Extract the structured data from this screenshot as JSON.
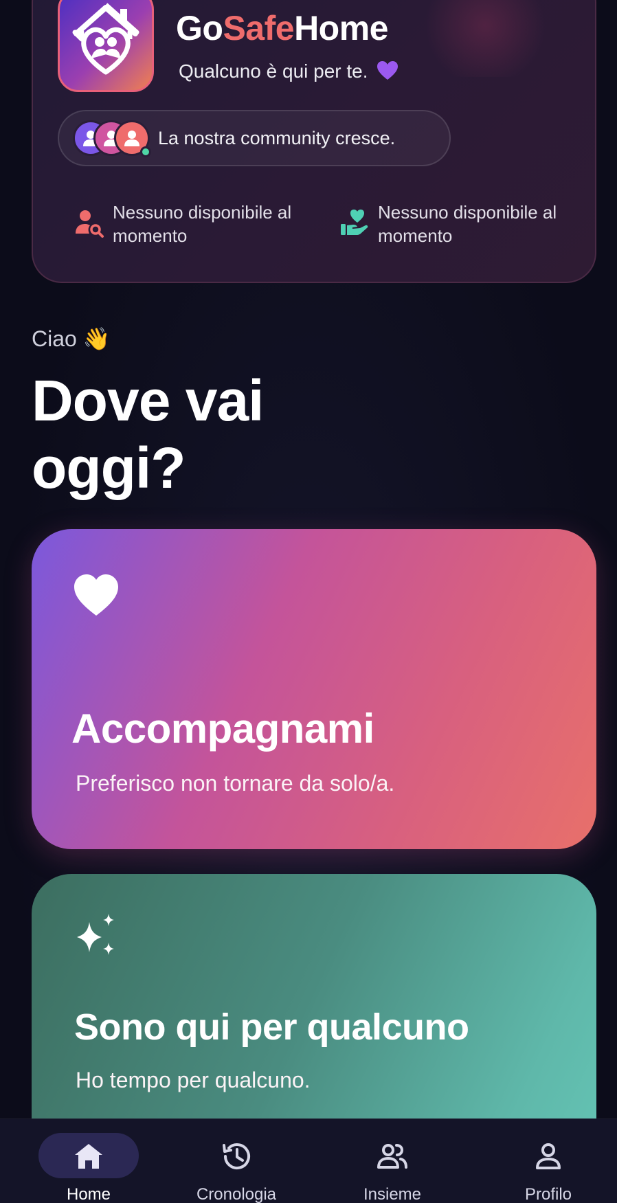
{
  "header": {
    "brand": {
      "part1": "Go",
      "part2": "Safe",
      "part3": "Home"
    },
    "tagline": "Qualcuno è qui per te.",
    "tagline_emoji": "💜",
    "community_text": "La nostra community cresce.",
    "stats": [
      {
        "icon": "person-search-icon",
        "text": "Nessuno disponibile al momento"
      },
      {
        "icon": "hand-heart-icon",
        "text": "Nessuno disponibile al momento"
      }
    ]
  },
  "greeting": {
    "hello": "Ciao",
    "hello_emoji": "👋",
    "title": "Dove vai oggi?"
  },
  "cards": {
    "accompany": {
      "title": "Accompagnami",
      "subtitle": "Preferisco non tornare da solo/a.",
      "icon": "heart-icon"
    },
    "here_for_someone": {
      "title": "Sono qui per qualcuno",
      "subtitle": "Ho tempo per qualcuno.",
      "icon": "sparkles-icon"
    }
  },
  "nav": {
    "home": "Home",
    "history": "Cronologia",
    "together": "Insieme",
    "profile": "Profilo",
    "active": "home"
  },
  "colors": {
    "accent_coral": "#ef6c6c",
    "accent_purple": "#7b57e8",
    "accent_teal": "#5fb8aa",
    "nav_active_bg": "#2b2854",
    "background": "#0d0d1c"
  }
}
